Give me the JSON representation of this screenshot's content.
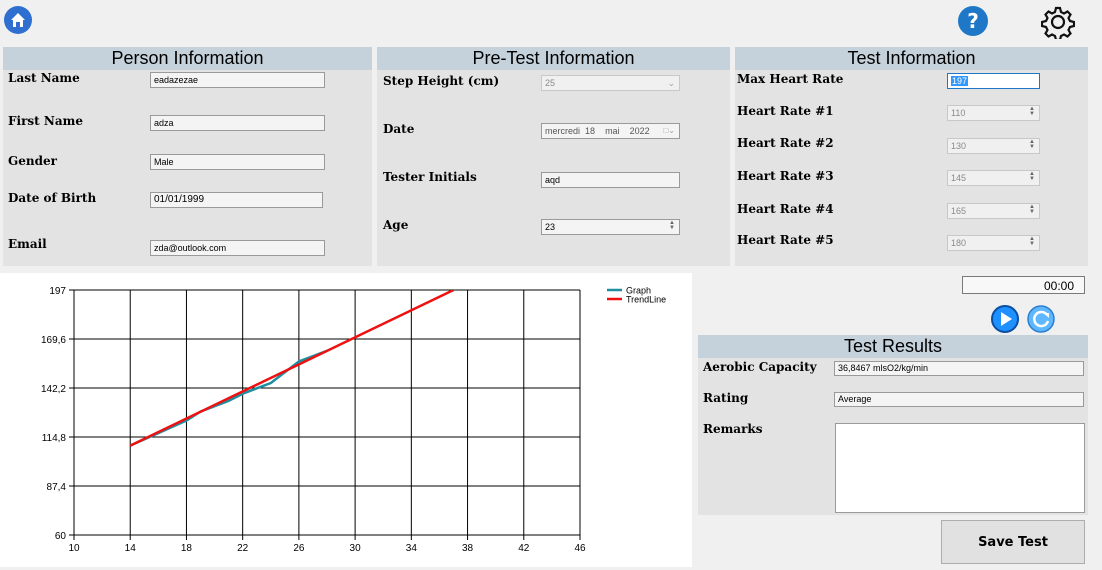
{
  "person": {
    "title": "Person Information",
    "last_name_label": "Last Name",
    "last_name": "eadazezae",
    "first_name_label": "First Name",
    "first_name": "adza",
    "gender_label": "Gender",
    "gender": "Male",
    "dob_label": "Date of Birth",
    "dob": "01/01/1999",
    "email_label": "Email",
    "email": "zda@outlook.com"
  },
  "pretest": {
    "title": "Pre-Test Information",
    "step_height_label": "Step Height (cm)",
    "step_height": "25",
    "date_label": "Date",
    "date_day": "mercredi",
    "date_num": "18",
    "date_month": "mai",
    "date_year": "2022",
    "tester_label": "Tester Initials",
    "tester": "aqd",
    "age_label": "Age",
    "age": "23"
  },
  "test": {
    "title": "Test Information",
    "max_hr_label": "Max Heart Rate",
    "max_hr": "197",
    "hr1_label": "Heart Rate #1",
    "hr1": "110",
    "hr2_label": "Heart Rate #2",
    "hr2": "130",
    "hr3_label": "Heart Rate #3",
    "hr3": "145",
    "hr4_label": "Heart Rate #4",
    "hr4": "165",
    "hr5_label": "Heart Rate #5",
    "hr5": "180"
  },
  "timer": "00:00",
  "results": {
    "title": "Test Results",
    "aerobic_label": "Aerobic Capacity",
    "aerobic": "36,8467 mlsO2/kg/min",
    "rating_label": "Rating",
    "rating": "Average",
    "remarks_label": "Remarks",
    "remarks": ""
  },
  "save_label": "Save Test",
  "icons": {
    "home": "home-icon",
    "help": "help-icon",
    "settings": "gear-icon",
    "play": "play-icon",
    "reset": "refresh-icon"
  },
  "colors": {
    "panel_header": "#c5d2dc",
    "panel_bg": "#e3e3e3",
    "accent_blue": "#1e77c7",
    "graph_line": "#1f8fa0",
    "trend_line": "#ee1111"
  },
  "chart_data": {
    "type": "line",
    "xlim": [
      10,
      46
    ],
    "ylim": [
      60,
      197
    ],
    "x_ticks": [
      10,
      14,
      18,
      22,
      26,
      30,
      34,
      38,
      42,
      46
    ],
    "y_ticks": [
      "60",
      "87,4",
      "114,8",
      "142,2",
      "169,6",
      "197"
    ],
    "y_tick_values": [
      60,
      87.4,
      114.8,
      142.2,
      169.6,
      197
    ],
    "series": [
      {
        "name": "Graph",
        "color": "#1f8fa0",
        "x": [
          14,
          16,
          18,
          19,
          21,
          22,
          24,
          26,
          28
        ],
        "y": [
          110,
          117,
          124,
          129,
          135,
          139,
          145,
          157,
          163
        ]
      },
      {
        "name": "TrendLine",
        "color": "#ee1111",
        "x": [
          14,
          37
        ],
        "y": [
          110,
          197
        ]
      }
    ],
    "legend_position": "top-right",
    "grid": true
  }
}
